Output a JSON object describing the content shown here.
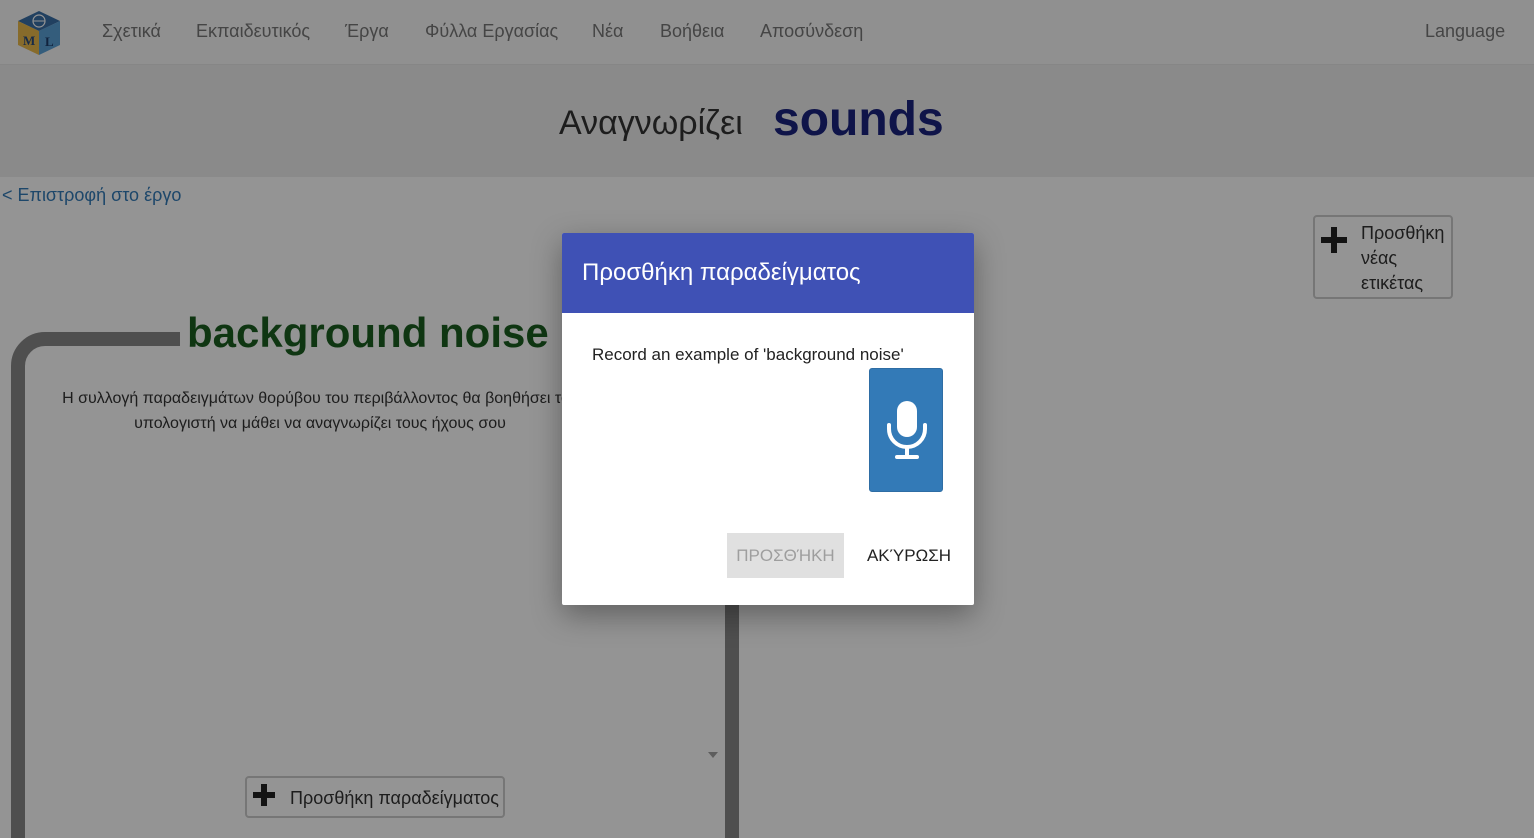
{
  "navbar": {
    "logo_icon": "ml-cube-logo-icon",
    "items": [
      "Σχετικά",
      "Εκπαιδευτικός",
      "Έργα",
      "Φύλλα Εργασίας",
      "Νέα",
      "Βοήθεια",
      "Αποσύνδεση"
    ],
    "language": "Language"
  },
  "header": {
    "label": "Αναγνωρίζει",
    "project_type": "sounds"
  },
  "back_link": "< Επιστροφή στο έργο",
  "add_label_button": {
    "icon": "plus-icon",
    "label": "Προσθήκη νέας ετικέτας"
  },
  "bucket": {
    "title": "background noise",
    "description": "Η συλλογή παραδειγμάτων θορύβου του περιβάλλοντος θα βοηθήσει τον υπολογιστή να μάθει να αναγνωρίζει τους ήχους σου",
    "add_example_label": "Προσθήκη παραδείγματος",
    "add_example_icon": "plus-icon"
  },
  "dialog": {
    "title": "Προσθήκη παραδείγματος",
    "prompt": "Record an example of 'background noise'",
    "mic_icon": "microphone-icon",
    "add_button": "ΠΡΟΣΘΉΚΗ",
    "cancel_button": "ΑΚΎΡΩΣΗ"
  },
  "colors": {
    "dialog_header": "#3f51b5",
    "mic_button": "#337ab7",
    "project_title": "#1a237e",
    "bucket_title": "#1b5e20",
    "link": "#337ab7"
  }
}
